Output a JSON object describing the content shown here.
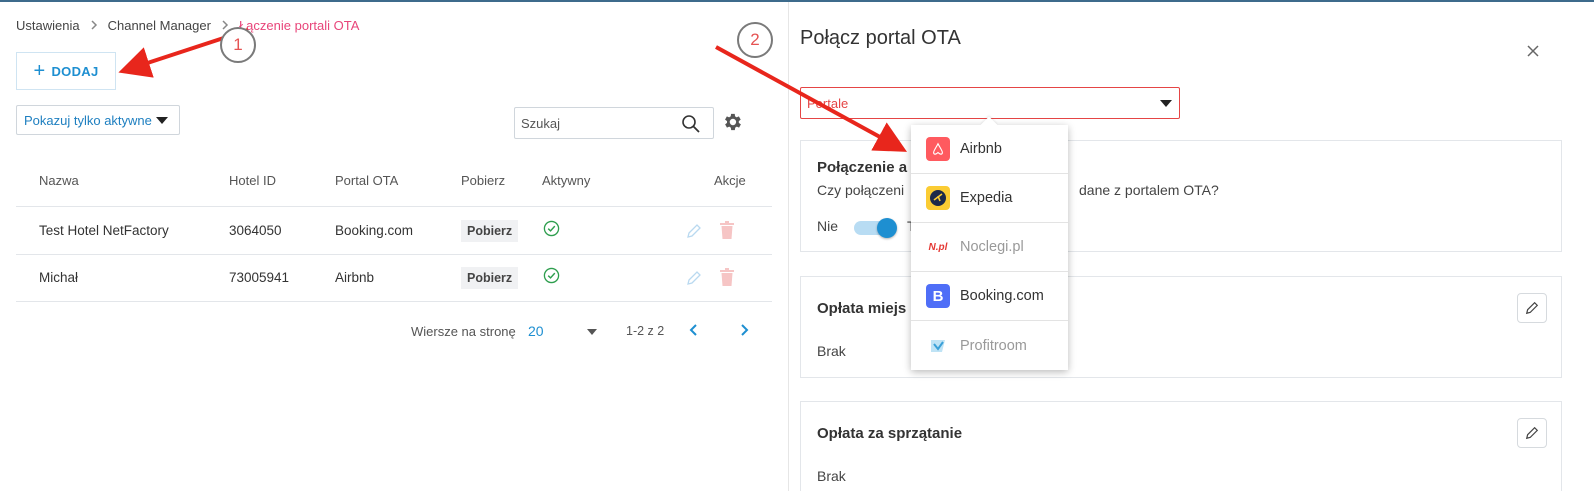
{
  "breadcrumb": {
    "items": [
      "Ustawienia",
      "Channel Manager",
      "Łączenie portali OTA"
    ],
    "separator": "›"
  },
  "toolbar": {
    "add_label": "DODAJ",
    "filter_label": "Pokazuj tylko aktywne",
    "search_placeholder": "Szukaj"
  },
  "table": {
    "headers": [
      "Nazwa",
      "Hotel ID",
      "Portal OTA",
      "Pobierz",
      "Aktywny",
      "Akcje"
    ],
    "rows": [
      {
        "name": "Test Hotel NetFactory",
        "hotel_id": "3064050",
        "portal": "Booking.com",
        "pobierz": "Pobierz",
        "active": true
      },
      {
        "name": "Michał",
        "hotel_id": "73005941",
        "portal": "Airbnb",
        "pobierz": "Pobierz",
        "active": true
      }
    ]
  },
  "pagination": {
    "rows_label": "Wiersze na stronę",
    "rows_per_page": "20",
    "range": "1-2 z 2"
  },
  "panel": {
    "title": "Połącz portal OTA",
    "portal_placeholder": "Portale",
    "cards": [
      {
        "title": "Połączenie a",
        "text": "Czy połączeni",
        "text_tail": "dane z portalem OTA?",
        "toggle_off_label": "Nie",
        "toggle_on_label": "T"
      },
      {
        "title": "Opłata miejs",
        "value": "Brak"
      },
      {
        "title": "Opłata za sprzątanie",
        "value": "Brak"
      }
    ]
  },
  "dropdown": {
    "options": [
      {
        "label": "Airbnb",
        "icon": "airbnb-logo-icon",
        "color": "#ff5a5f",
        "enabled": true
      },
      {
        "label": "Expedia",
        "icon": "expedia-logo-icon",
        "color": "#fbcc33",
        "enabled": true
      },
      {
        "label": "Noclegi.pl",
        "icon": "noclegi-logo-icon",
        "color": "#e53935",
        "enabled": false
      },
      {
        "label": "Booking.com",
        "icon": "booking-logo-icon",
        "color": "#4f6ef7",
        "enabled": true
      },
      {
        "label": "Profitroom",
        "icon": "profitroom-logo-icon",
        "color": "#3aa0d8",
        "enabled": false
      }
    ]
  },
  "annotations": {
    "step1": "1",
    "step2": "2",
    "arrow_color": "#e8261c"
  },
  "colors": {
    "accent": "#1e8fd1",
    "breadcrumb_active": "#e8457a",
    "error": "#e54545",
    "success": "#2e9e4e"
  }
}
